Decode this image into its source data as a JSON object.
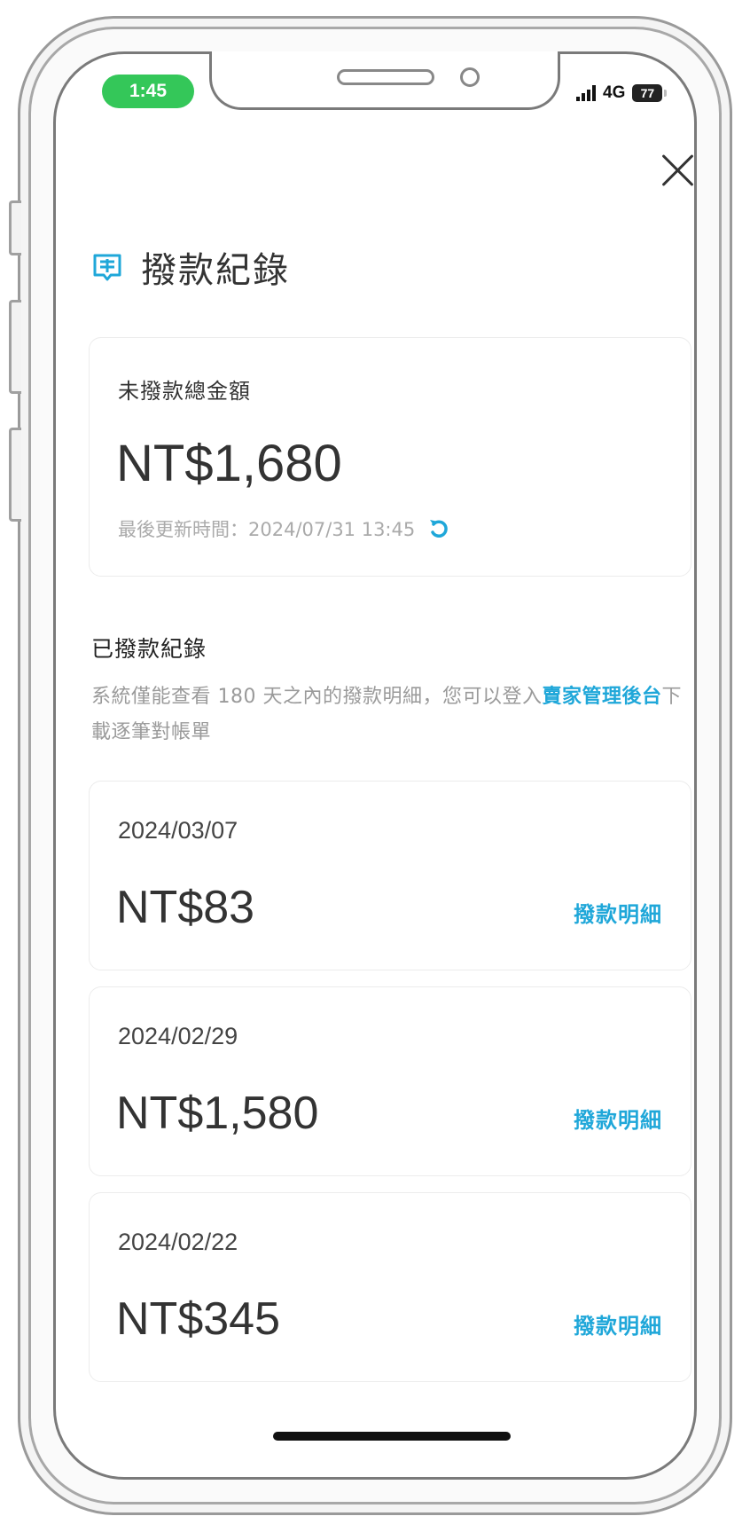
{
  "status_bar": {
    "time": "1:45",
    "network": "4G",
    "battery": "77"
  },
  "header": {
    "title": "撥款紀錄",
    "title_icon": "payout-receipt-icon",
    "close_icon": "close-icon"
  },
  "summary": {
    "label": "未撥款總金額",
    "amount": "NT$1,680",
    "updated_label": "最後更新時間：2024/07/31 13:45",
    "refresh_icon": "refresh-icon"
  },
  "history": {
    "title": "已撥款紀錄",
    "notice_text": "系統僅能查看 180 天之內的撥款明細，您可以登入",
    "notice_link": "賣家管理後台",
    "notice_suffix": "下載逐筆對帳單"
  },
  "records": [
    {
      "date": "2024/03/07",
      "amount": "NT$83",
      "link": "撥款明細"
    },
    {
      "date": "2024/02/29",
      "amount": "NT$1,580",
      "link": "撥款明細"
    },
    {
      "date": "2024/02/22",
      "amount": "NT$345",
      "link": "撥款明細"
    }
  ],
  "colors": {
    "accent": "#1fa7d9",
    "status_pill": "#34c759",
    "text": "#333333",
    "muted": "#aaaaaa"
  }
}
